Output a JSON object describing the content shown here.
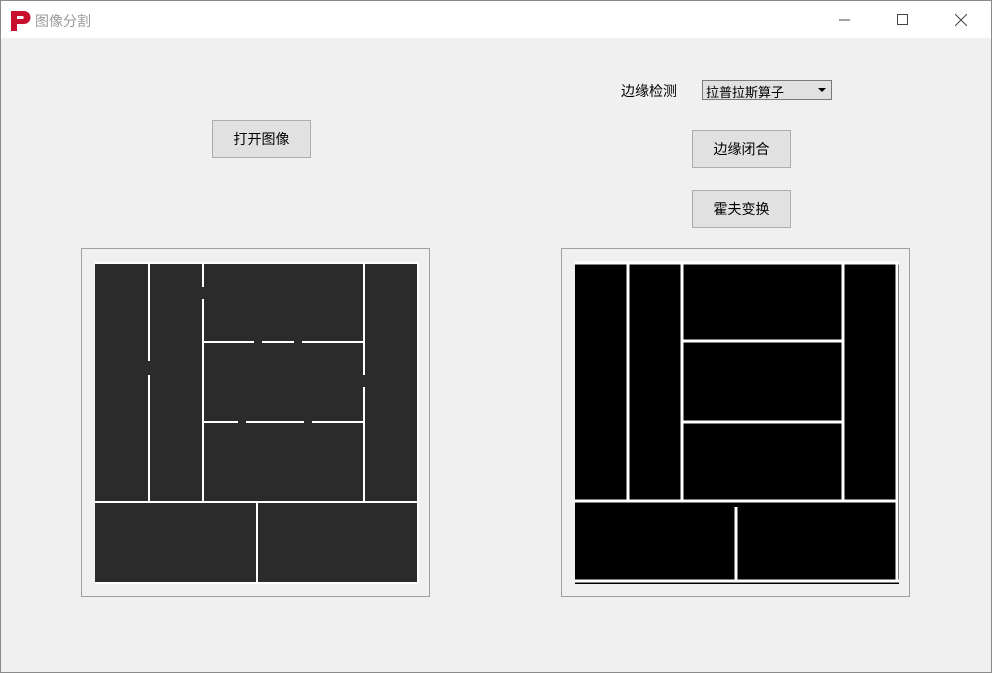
{
  "window": {
    "title": "图像分割",
    "icon": "app-p-icon",
    "controls": {
      "minimize": "minimize-icon",
      "maximize": "maximize-icon",
      "close": "close-icon"
    }
  },
  "toolbar": {
    "open_image_label": "打开图像",
    "edge_detect_label": "边缘检测",
    "edge_detect_selected": "拉普拉斯算子",
    "edge_close_label": "边缘闭合",
    "hough_label": "霍夫变换"
  },
  "colors": {
    "accent": "#c8102e",
    "window_bg": "#f0f0f0",
    "left_image_fill": "#2b2b2b",
    "right_image_fill": "#000000"
  }
}
